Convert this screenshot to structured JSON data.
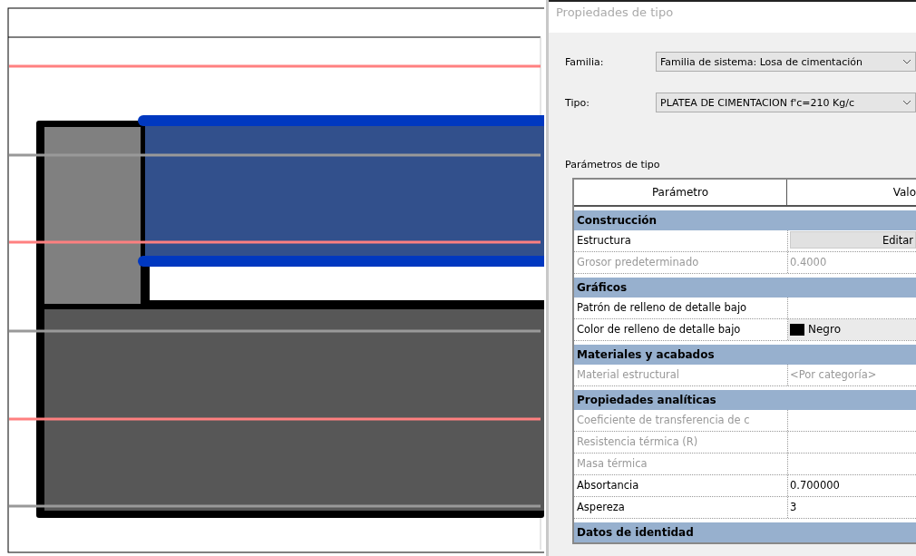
{
  "dialog": {
    "title": "Propiedades de tipo",
    "fields": [
      {
        "label": "Familia:",
        "value": "Familia de sistema: Losa de cimentación"
      },
      {
        "label": "Tipo:",
        "value": "PLATEA DE CIMENTACION f'c=210 Kg/c"
      }
    ],
    "section_label": "Parámetros de tipo",
    "table": {
      "columns": [
        "Parámetro",
        "Valo"
      ],
      "groups": [
        {
          "name": "Construcción",
          "rows": [
            {
              "kind": "button",
              "parameter": "Estructura",
              "value": "Editar",
              "disabled": false
            },
            {
              "kind": "text",
              "parameter": "Grosor predeterminado",
              "value": "0.4000",
              "disabled": true
            }
          ]
        },
        {
          "name": "Gráficos",
          "rows": [
            {
              "kind": "text",
              "parameter": "Patrón de relleno de detalle bajo",
              "disabled": false
            },
            {
              "kind": "color",
              "parameter": "Color de relleno de detalle bajo",
              "value": "Negro",
              "color": "#000000",
              "disabled": false
            }
          ]
        },
        {
          "name": "Materiales y acabados",
          "rows": [
            {
              "kind": "text",
              "parameter": "Material estructural",
              "value": "<Por categoría>",
              "disabled": true
            }
          ]
        },
        {
          "name": "Propiedades analíticas",
          "rows": [
            {
              "kind": "text",
              "parameter": "Coeficiente de transferencia de c",
              "disabled": true
            },
            {
              "kind": "text",
              "parameter": "Resistencia térmica (R)",
              "disabled": true
            },
            {
              "kind": "text",
              "parameter": "Masa térmica",
              "disabled": true
            },
            {
              "kind": "text",
              "parameter": "Absortancia",
              "value": "0.700000",
              "disabled": false
            },
            {
              "kind": "text",
              "parameter": "Aspereza",
              "value": "3",
              "disabled": false
            }
          ]
        },
        {
          "name": "Datos de identidad"
        }
      ]
    }
  }
}
